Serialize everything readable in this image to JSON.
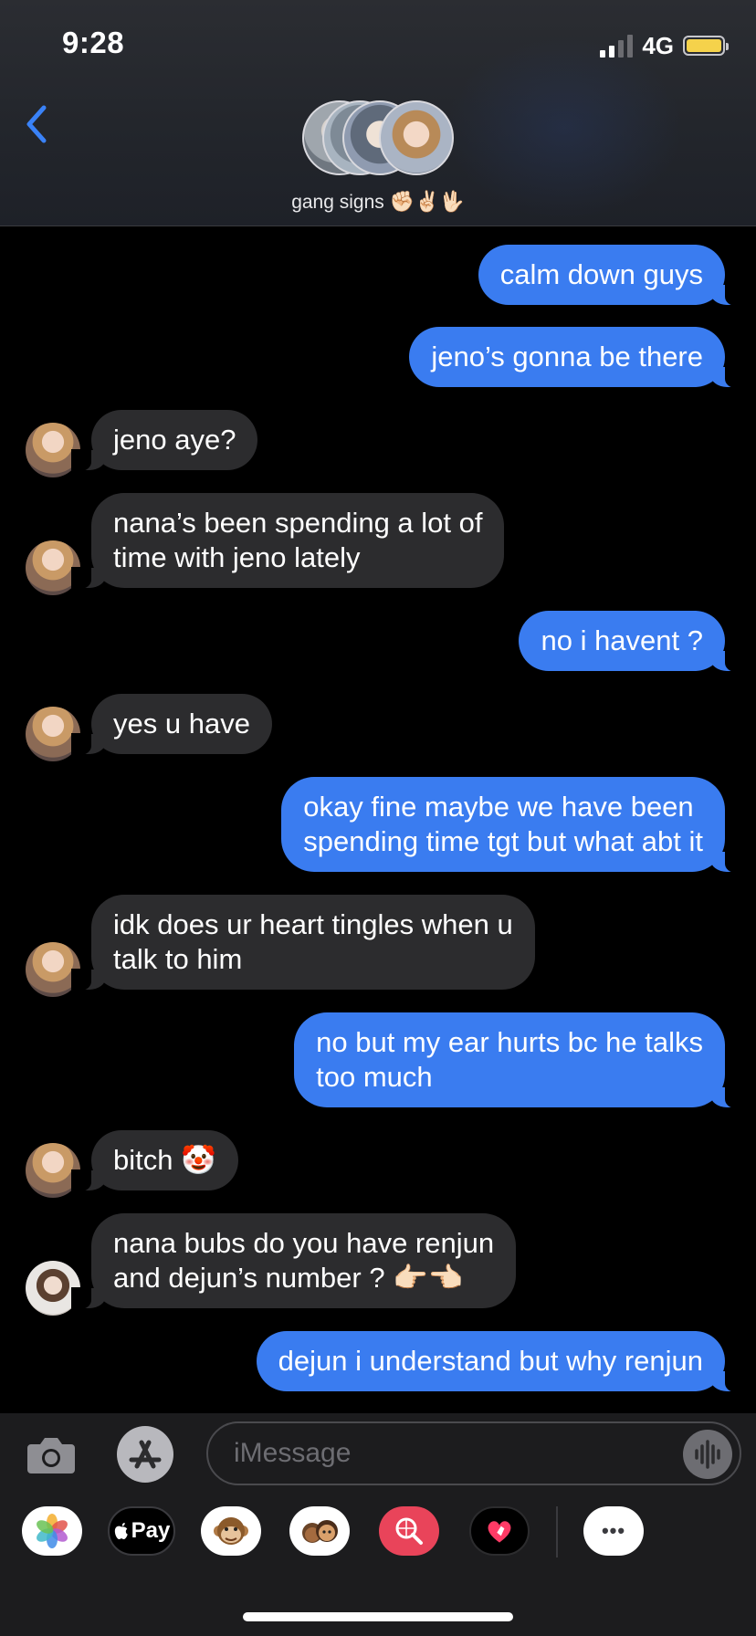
{
  "status_bar": {
    "time": "9:28",
    "network": "4G"
  },
  "conversation": {
    "title": "gang signs",
    "title_emoji": "✊🏻✌🏻🖖🏻"
  },
  "messages": [
    {
      "side": "out",
      "text": "calm down guys"
    },
    {
      "side": "out",
      "text": "jeno’s gonna be there"
    },
    {
      "side": "in",
      "text": "jeno aye?"
    },
    {
      "side": "in",
      "text": "nana’s been spending a lot of\ntime with jeno lately"
    },
    {
      "side": "out",
      "text": "no i havent ?"
    },
    {
      "side": "in",
      "text": "yes u have"
    },
    {
      "side": "out",
      "text": "okay fine maybe we have been\nspending time tgt but what abt it"
    },
    {
      "side": "in",
      "text": "idk does ur heart tingles when u\ntalk to him"
    },
    {
      "side": "out",
      "text": "no but my ear hurts bc he talks\ntoo much"
    },
    {
      "side": "in",
      "text": "bitch 🤡"
    },
    {
      "side": "in",
      "text": "nana bubs do you have renjun\nand dejun’s number ? 👉🏻👈🏻"
    },
    {
      "side": "out",
      "text": "dejun i understand but why renjun"
    }
  ],
  "compose": {
    "placeholder": "iMessage"
  },
  "app_drawer": {
    "items": [
      "photos-app-icon",
      "apple-pay-icon",
      "animoji-icon",
      "memoji-icon",
      "image-search-icon",
      "digital-touch-icon",
      "more-apps-icon"
    ],
    "apple_pay_label": "Pay",
    "more_label": "•••"
  }
}
